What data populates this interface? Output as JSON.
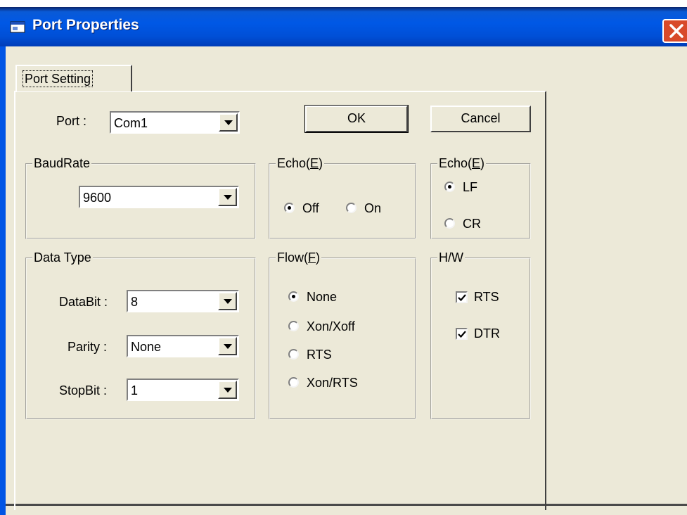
{
  "window": {
    "title": "Port Properties",
    "title_icon": "app-window-icon",
    "close_icon": "close-icon"
  },
  "tabs": [
    {
      "label": "Port Setting",
      "selected": true
    }
  ],
  "port": {
    "label": "Port :",
    "value": "Com1"
  },
  "buttons": {
    "ok": "OK",
    "cancel": "Cancel"
  },
  "baudrate": {
    "title": "BaudRate",
    "value": "9600"
  },
  "echo": {
    "title_prefix": "Echo(",
    "title_hotkey": "E",
    "title_suffix": ")",
    "options": [
      {
        "label": "Off",
        "selected": true
      },
      {
        "label": "On",
        "selected": false
      }
    ]
  },
  "echo2": {
    "title_prefix": "Echo(",
    "title_hotkey": "E",
    "title_suffix": ")",
    "options": [
      {
        "label": "LF",
        "selected": true
      },
      {
        "label": "CR",
        "selected": false
      }
    ]
  },
  "data_type": {
    "title": "Data Type",
    "databit": {
      "label": "DataBit :",
      "value": "8"
    },
    "parity": {
      "label": "Parity :",
      "value": "None"
    },
    "stopbit": {
      "label": "StopBit :",
      "value": "1"
    }
  },
  "flow": {
    "title_prefix": "Flow(",
    "title_hotkey": "F",
    "title_suffix": ")",
    "options": [
      {
        "label": "None",
        "selected": true
      },
      {
        "label": "Xon/Xoff",
        "selected": false
      },
      {
        "label": "RTS",
        "selected": false
      },
      {
        "label": "Xon/RTS",
        "selected": false
      }
    ]
  },
  "hw": {
    "title": "H/W",
    "checks": [
      {
        "label": "RTS",
        "checked": true
      },
      {
        "label": "DTR",
        "checked": true
      }
    ]
  },
  "colors": {
    "titlebar": "#0058e6",
    "dialog": "#ece9d8",
    "close": "#d84a2a"
  }
}
